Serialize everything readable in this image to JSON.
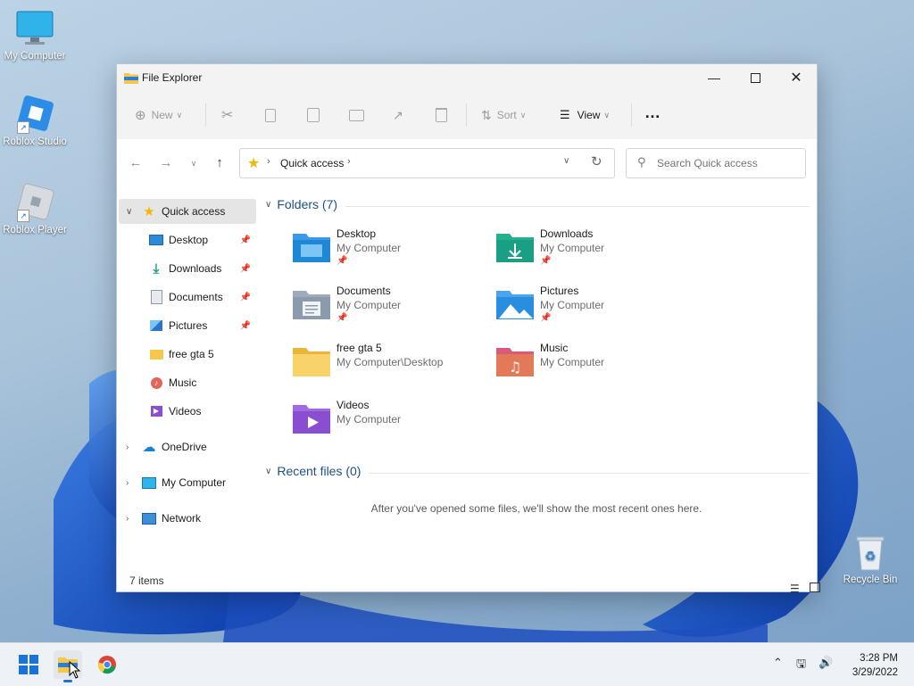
{
  "desktop": {
    "icons": [
      {
        "label": "My Computer"
      },
      {
        "label": "Roblox Studio"
      },
      {
        "label": "Roblox Player"
      },
      {
        "label": "Recycle Bin"
      }
    ]
  },
  "window": {
    "title": "File Explorer",
    "toolbar": {
      "new_label": "New",
      "sort_label": "Sort",
      "view_label": "View",
      "more_label": "…"
    },
    "address": {
      "location": "Quick access",
      "search_placeholder": "Search Quick access"
    },
    "sidebar": {
      "items": [
        {
          "label": "Quick access",
          "icon": "star-icon"
        },
        {
          "label": "Desktop",
          "icon": "desktop-icon"
        },
        {
          "label": "Downloads",
          "icon": "download-icon"
        },
        {
          "label": "Documents",
          "icon": "document-icon"
        },
        {
          "label": "Pictures",
          "icon": "picture-icon"
        },
        {
          "label": "free gta 5",
          "icon": "folder-icon"
        },
        {
          "label": "Music",
          "icon": "music-icon"
        },
        {
          "label": "Videos",
          "icon": "video-icon"
        },
        {
          "label": "OneDrive",
          "icon": "cloud-icon"
        },
        {
          "label": "My Computer",
          "icon": "computer-icon"
        },
        {
          "label": "Network",
          "icon": "network-icon"
        }
      ]
    },
    "folders_header": "Folders (7)",
    "folders": [
      {
        "name": "Desktop",
        "location": "My Computer",
        "pinned": true,
        "color": "#1e88d6"
      },
      {
        "name": "Downloads",
        "location": "My Computer",
        "pinned": true,
        "color": "#1a9e84"
      },
      {
        "name": "Documents",
        "location": "My Computer",
        "pinned": true,
        "color": "#8c9aad"
      },
      {
        "name": "Pictures",
        "location": "My Computer",
        "pinned": true,
        "color": "#2a8ee0"
      },
      {
        "name": "free gta 5",
        "location": "My Computer\\Desktop",
        "pinned": false,
        "color": "#f5c84c"
      },
      {
        "name": "Music",
        "location": "My Computer",
        "pinned": false,
        "color": "#e2645a"
      },
      {
        "name": "Videos",
        "location": "My Computer",
        "pinned": false,
        "color": "#8a4fd0"
      }
    ],
    "recent_header": "Recent files (0)",
    "recent_empty": "After you've opened some files, we'll show the most recent ones here.",
    "status": "7 items"
  },
  "taskbar": {
    "time": "3:28 PM",
    "date": "3/29/2022"
  }
}
